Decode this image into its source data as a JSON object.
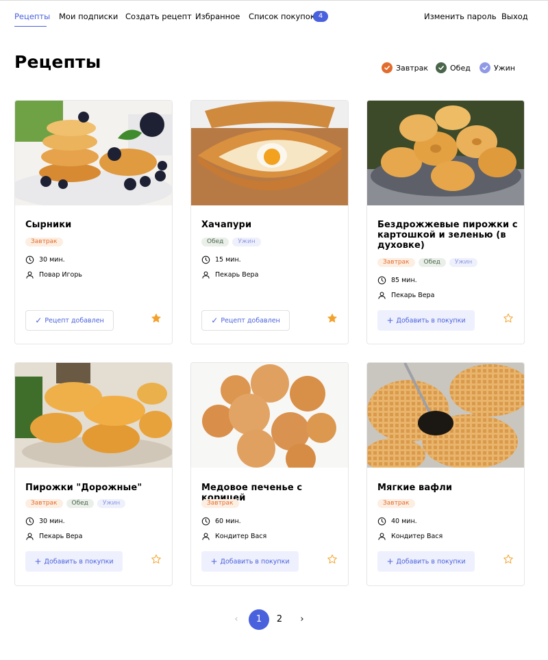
{
  "nav": {
    "items": [
      {
        "label": "Рецепты"
      },
      {
        "label": "Мои подписки"
      },
      {
        "label": "Создать рецепт"
      },
      {
        "label": "Избранное"
      },
      {
        "label": "Список покупок"
      }
    ],
    "cart_count": "4",
    "change_password": "Изменить пароль",
    "logout": "Выход",
    "accent_color": "#4a61dd"
  },
  "page": {
    "title": "Рецепты"
  },
  "filters": [
    {
      "label": "Завтрак",
      "color": "#e26c2d",
      "checked": true
    },
    {
      "label": "Обед",
      "color": "#49654a",
      "checked": true
    },
    {
      "label": "Ужин",
      "color": "#8f99e6",
      "checked": true
    }
  ],
  "recipes": [
    {
      "title": "Сырники",
      "tags": [
        "Завтрак"
      ],
      "time": "30 мин.",
      "author": "Повар Игорь",
      "button": "Рецепт добавлен",
      "favorite": true,
      "image": "syrniki"
    },
    {
      "title": "Хачапури",
      "tags": [
        "Обед",
        "Ужин"
      ],
      "time": "15 мин.",
      "author": "Пекарь Вера",
      "button": "Рецепт добавлен",
      "favorite": true,
      "image": "khachapuri"
    },
    {
      "title": "Бездрожжевые пирожки с картошкой и зеленью (в духовке)",
      "tags": [
        "Завтрак",
        "Обед",
        "Ужин"
      ],
      "time": "85 мин.",
      "author": "Пекарь Вера",
      "button": "Добавить в покупки",
      "favorite": false,
      "image": "pirozhki"
    },
    {
      "title": "Пирожки \"Дорожные\"",
      "tags": [
        "Завтрак",
        "Обед",
        "Ужин"
      ],
      "time": "30 мин.",
      "author": "Пекарь Вера",
      "button": "Добавить в покупки",
      "favorite": false,
      "image": "pirozhki-dorozhnye"
    },
    {
      "title": "Медовое печенье с корицей",
      "tags": [
        "Завтрак"
      ],
      "time": "60 мин.",
      "author": "Кондитер Вася",
      "button": "Добавить в покупки",
      "favorite": false,
      "image": "cookies"
    },
    {
      "title": "Мягкие вафли",
      "tags": [
        "Завтрак"
      ],
      "time": "40 мин.",
      "author": "Кондитер Вася",
      "button": "Добавить в покупки",
      "favorite": false,
      "image": "waffles"
    }
  ],
  "pagination": {
    "pages": [
      "1",
      "2"
    ],
    "current": "1"
  }
}
